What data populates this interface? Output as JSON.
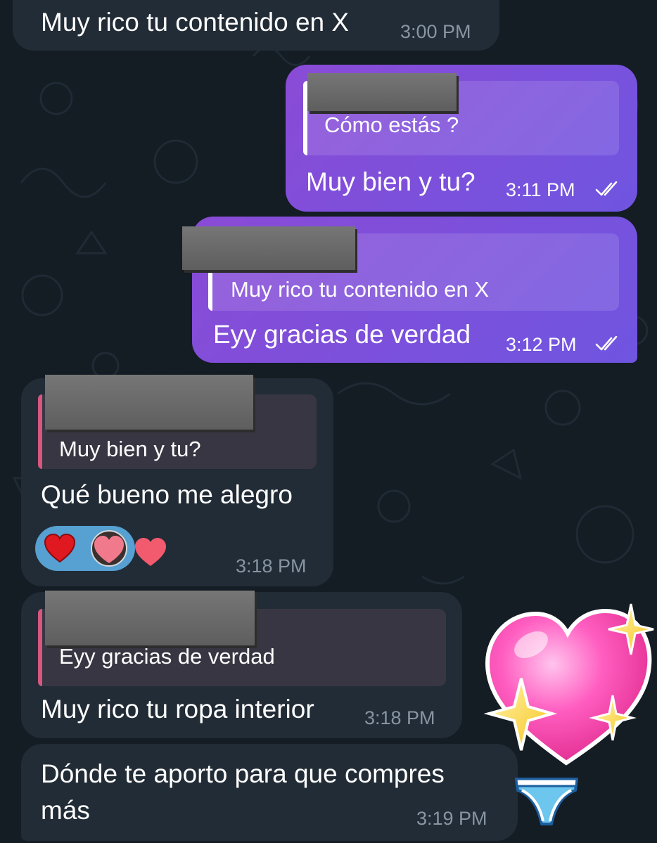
{
  "colors": {
    "background": "#141c24",
    "incoming_bubble": "#222c36",
    "outgoing_bubble_start": "#8a4bd6",
    "outgoing_bubble_end": "#6f55e0",
    "reply_accent_incoming": "#d6577f",
    "reaction_pill": "#56a0d2"
  },
  "messages": [
    {
      "direction": "in",
      "text": "Muy rico tu contenido en X",
      "time": "3:00 PM"
    },
    {
      "direction": "out",
      "reply_to": "Cómo estás ?",
      "text": "Muy bien y tu?",
      "time": "3:11 PM",
      "status_icon": "double-check-icon"
    },
    {
      "direction": "out",
      "reply_to": "Muy rico tu contenido en X",
      "text": "Eyy gracias de verdad",
      "time": "3:12 PM",
      "status_icon": "double-check-icon"
    },
    {
      "direction": "in",
      "reply_to": "Muy bien y tu?",
      "text": "Qué bueno me alegro",
      "time": "3:18 PM",
      "reactions": [
        "red-heart-icon",
        "reactor-avatar",
        "pink-heart-icon"
      ]
    },
    {
      "direction": "in",
      "reply_to": "Eyy gracias de verdad",
      "text": "Muy rico tu ropa interior",
      "time": "3:18 PM",
      "sticker": "sparkling-heart-icon"
    },
    {
      "direction": "in",
      "text_line1": "Dónde te aporto para que compres",
      "text_line2": "más",
      "time": "3:19 PM",
      "sticker": "underwear-icon"
    }
  ]
}
